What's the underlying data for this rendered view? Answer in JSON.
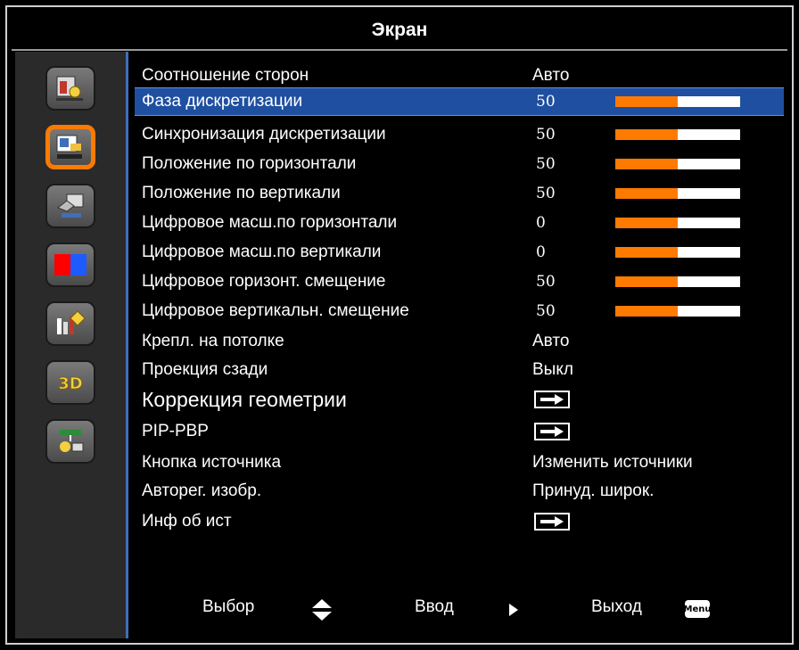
{
  "title": "Экран",
  "sidebar": {
    "icons": [
      {
        "name": "picture-settings-icon"
      },
      {
        "name": "screen-settings-icon",
        "active": true
      },
      {
        "name": "setup-hand-icon"
      },
      {
        "name": "color-blocks-icon"
      },
      {
        "name": "info-bars-icon"
      },
      {
        "name": "3d-icon",
        "text": "3D"
      },
      {
        "name": "network-icon"
      }
    ]
  },
  "menu": {
    "rows": [
      {
        "label": "Соотношение сторон",
        "value": "Авто"
      },
      {
        "label": "Фаза дискретизации",
        "value": "50",
        "bar": 0.5
      },
      {
        "label": "Синхронизация дискретизации",
        "value": "50",
        "bar": 0.5
      },
      {
        "label": "Положение по горизонтали",
        "value": "50",
        "bar": 0.5
      },
      {
        "label": "Положение по вертикали",
        "value": "50",
        "bar": 0.5
      },
      {
        "label": "Цифровое масш.по горизонтали",
        "value": "0",
        "bar": 0.5
      },
      {
        "label": "Цифровое масш.по вертикали",
        "value": "0",
        "bar": 0.5
      },
      {
        "label": "Цифровое горизонт. смещение",
        "value": "50",
        "bar": 0.5
      },
      {
        "label": "Цифровое вертикальн. смещение",
        "value": "50",
        "bar": 0.5
      },
      {
        "label": "Крепл. на потолке",
        "value": "Авто"
      },
      {
        "label": "Проекция сзади",
        "value": "Выкл"
      },
      {
        "label": "Коррекция геометрии",
        "submenu": true
      },
      {
        "label": "PIP-PBP",
        "submenu": true
      },
      {
        "label": "Кнопка источника",
        "value": "Изменить источники"
      },
      {
        "label": "Авторег. изобр.",
        "value": "Принуд. широк."
      },
      {
        "label": "Инф об ист",
        "submenu": true
      }
    ],
    "selected_index": 1
  },
  "footer": {
    "select_label": "Выбор",
    "enter_label": "Ввод",
    "exit_label": "Выход",
    "menu_badge": "Menu"
  },
  "colors": {
    "accent_orange": "#ff7a00",
    "selection_blue": "#1f4fa0",
    "sidebar_border": "#3f6fb8"
  }
}
